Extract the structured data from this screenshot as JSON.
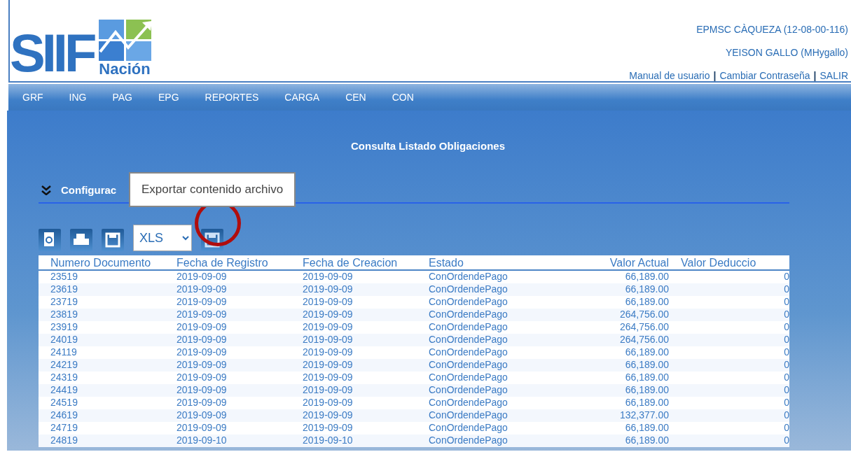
{
  "logo": {
    "main": "SIIF",
    "sub": "Nación"
  },
  "user_info": {
    "entity": "EPMSC CÀQUEZA (12-08-00-116)",
    "user": "YEISON GALLO (MHygallo)",
    "links": [
      {
        "kind": "link",
        "text": "Manual de usuario"
      },
      {
        "kind": "separator",
        "text": "|"
      },
      {
        "kind": "link",
        "text": "Cambiar Contraseña"
      },
      {
        "kind": "separator",
        "text": "|"
      },
      {
        "kind": "link",
        "text": "SALIR"
      }
    ]
  },
  "menu": [
    "GRF",
    "ING",
    "PAG",
    "EPG",
    "REPORTES",
    "CARGA",
    "CEN",
    "CON"
  ],
  "page_title": "Consulta Listado Obligaciones",
  "section": {
    "title": "Configurac",
    "expanded": true
  },
  "tooltip": "Exportar contenido archivo",
  "toolbar": {
    "format": "XLS",
    "highlighted_export": true
  },
  "table": {
    "columns": [
      "Numero Documento",
      "Fecha de Registro",
      "Fecha de Creacion",
      "Estado",
      "Valor Actual",
      "Valor Deduccio"
    ],
    "rows": [
      [
        "23519",
        "2019-09-09",
        "2019-09-09",
        "ConOrdendePago",
        "66,189.00",
        "0"
      ],
      [
        "23619",
        "2019-09-09",
        "2019-09-09",
        "ConOrdendePago",
        "66,189.00",
        "0"
      ],
      [
        "23719",
        "2019-09-09",
        "2019-09-09",
        "ConOrdendePago",
        "66,189.00",
        "0"
      ],
      [
        "23819",
        "2019-09-09",
        "2019-09-09",
        "ConOrdendePago",
        "264,756.00",
        "0"
      ],
      [
        "23919",
        "2019-09-09",
        "2019-09-09",
        "ConOrdendePago",
        "264,756.00",
        "0"
      ],
      [
        "24019",
        "2019-09-09",
        "2019-09-09",
        "ConOrdendePago",
        "264,756.00",
        "0"
      ],
      [
        "24119",
        "2019-09-09",
        "2019-09-09",
        "ConOrdendePago",
        "66,189.00",
        "0"
      ],
      [
        "24219",
        "2019-09-09",
        "2019-09-09",
        "ConOrdendePago",
        "66,189.00",
        "0"
      ],
      [
        "24319",
        "2019-09-09",
        "2019-09-09",
        "ConOrdendePago",
        "66,189.00",
        "0"
      ],
      [
        "24419",
        "2019-09-09",
        "2019-09-09",
        "ConOrdendePago",
        "66,189.00",
        "0"
      ],
      [
        "24519",
        "2019-09-09",
        "2019-09-09",
        "ConOrdendePago",
        "66,189.00",
        "0"
      ],
      [
        "24619",
        "2019-09-09",
        "2019-09-09",
        "ConOrdendePago",
        "132,377.00",
        "0"
      ],
      [
        "24719",
        "2019-09-09",
        "2019-09-09",
        "ConOrdendePago",
        "66,189.00",
        "0"
      ],
      [
        "24819",
        "2019-09-10",
        "2019-09-10",
        "ConOrdendePago",
        "66,189.00",
        "0"
      ]
    ]
  }
}
